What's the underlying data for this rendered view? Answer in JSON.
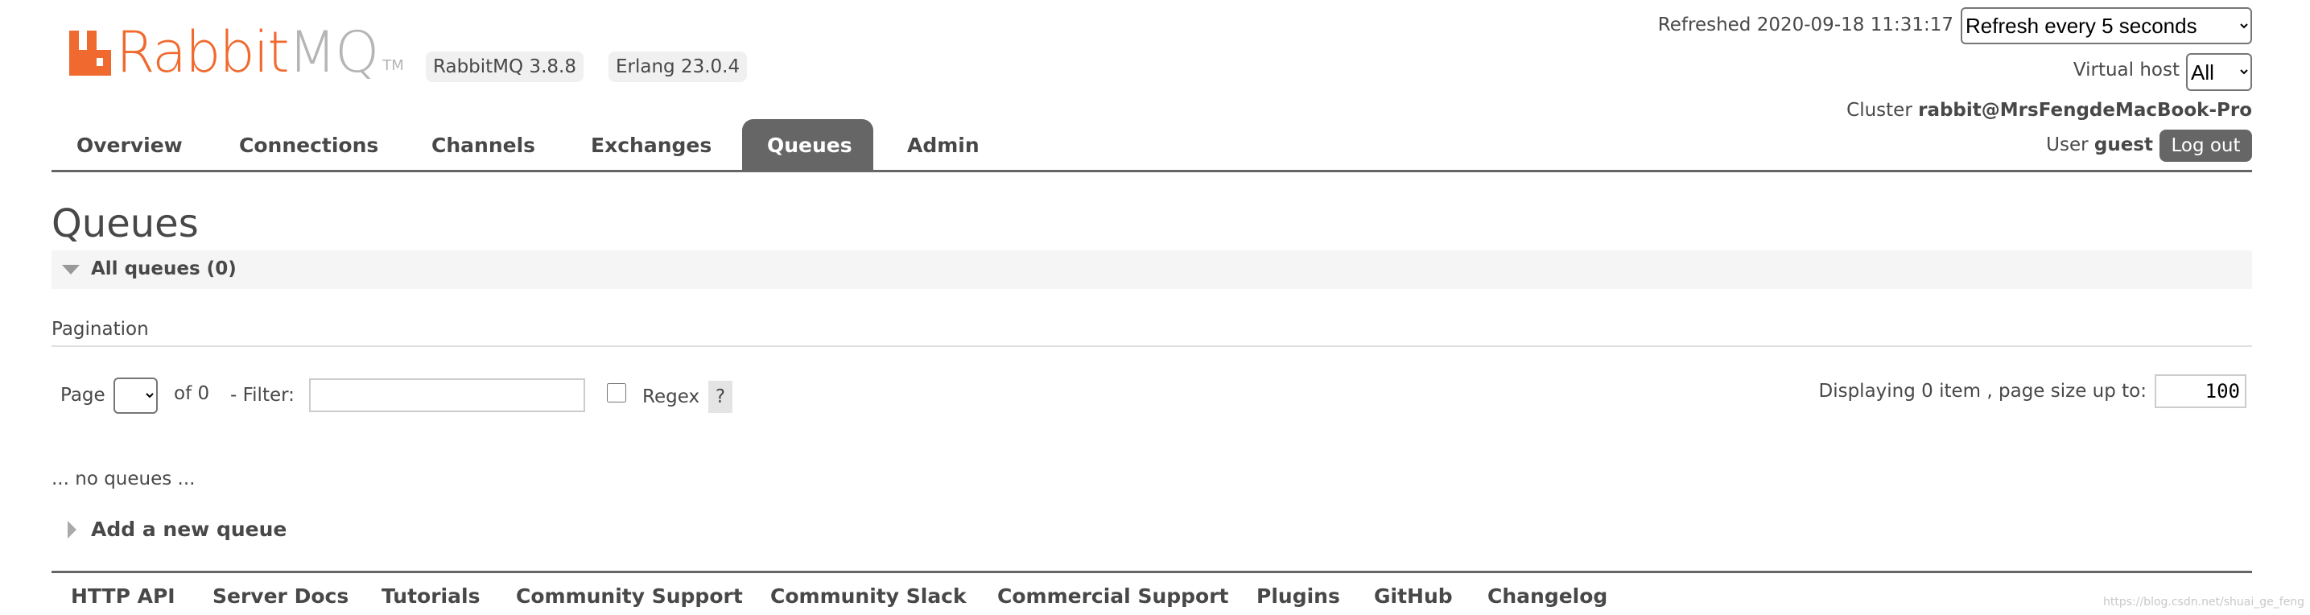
{
  "header": {
    "logo_text": "RabbitMQ",
    "logo_tm": "TM",
    "version_badge": "RabbitMQ 3.8.8",
    "erlang_badge": "Erlang 23.0.4",
    "refreshed": "Refreshed 2020-09-18 11:31:17",
    "refresh_select": "Refresh every 5 seconds",
    "virtual_host_label": "Virtual host",
    "virtual_host_select": "All",
    "cluster_label": "Cluster",
    "cluster_name": "rabbit@MrsFengdeMacBook-Pro",
    "user_label": "User",
    "user_name": "guest",
    "logout_label": "Log out",
    "brand_color": "#f06a2f"
  },
  "nav": {
    "tabs": [
      {
        "label": "Overview"
      },
      {
        "label": "Connections"
      },
      {
        "label": "Channels"
      },
      {
        "label": "Exchanges"
      },
      {
        "label": "Queues",
        "active": true
      },
      {
        "label": "Admin"
      }
    ]
  },
  "main": {
    "title": "Queues",
    "section_title": "All queues (0)",
    "pagination_label": "Pagination",
    "page_label": "Page",
    "page_select": "",
    "of_pages": "of 0",
    "filter_label": "- Filter:",
    "filter_value": "",
    "regex_label": "Regex",
    "regex_checked": false,
    "help_label": "?",
    "displaying": "Displaying 0 item , page size up to:",
    "page_size": "100",
    "empty_message": "... no queues ...",
    "add_queue": "Add a new queue"
  },
  "footer": {
    "links": [
      "HTTP API",
      "Server Docs",
      "Tutorials",
      "Community Support",
      "Community Slack",
      "Commercial Support",
      "Plugins",
      "GitHub",
      "Changelog"
    ]
  },
  "watermark": "https://blog.csdn.net/shuai_ge_feng"
}
